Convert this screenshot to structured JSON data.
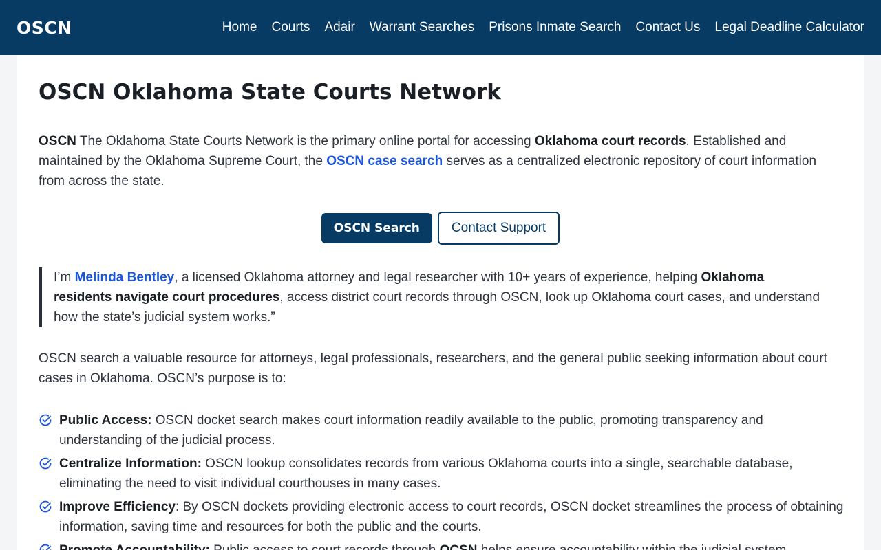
{
  "navbar": {
    "logo": "OSCN",
    "links": [
      "Home",
      "Courts",
      "Adair",
      "Warrant Searches",
      "Prisons Inmate Search",
      "Contact Us",
      "Legal Deadline Calculator"
    ]
  },
  "page": {
    "title": "OSCN Oklahoma State Courts Network",
    "intro": {
      "lead_bold": "OSCN",
      "t1": " The Oklahoma State Courts Network is the primary online portal for accessing ",
      "bold1": "Oklahoma court records",
      "t2": ". Established and maintained by the Oklahoma Supreme Court, the ",
      "link1": "OSCN case search",
      "t3": " serves as a centralized electronic repository of court information from across the state."
    },
    "buttons": {
      "primary": "OSCN Search",
      "secondary": "Contact Support"
    },
    "quote": {
      "t1": "I’m ",
      "author_link": "Melinda Bentley",
      "t2": ", a licensed Oklahoma attorney and legal researcher with 10+ years of experience, helping ",
      "bold1": "Oklahoma residents navigate court procedures",
      "t3": ", access district court records through OSCN, look up Oklahoma court cases, and understand how the state’s judicial system works.”"
    },
    "para2": "OSCN search a valuable resource for attorneys, legal professionals, researchers, and the general public seeking information about court cases in Oklahoma. OSCN’s purpose is to:",
    "purposes": [
      {
        "title": "Public Access:",
        "text": " OSCN docket search makes court information readily available to the public, promoting transparency and understanding of the judicial process."
      },
      {
        "title": "Centralize Information:",
        "text": " OSCN lookup consolidates records from various Oklahoma courts into a single, searchable database, eliminating the need to visit individual courthouses in many cases."
      },
      {
        "title": "Improve Efficiency",
        "text": ": By OSCN dockets providing electronic access to court records, OSCN docket streamlines the process of obtaining information, saving time and resources for both the public and the courts."
      },
      {
        "title": "Promote Accountability:",
        "text_pre": " Public access to court records through ",
        "text_bold": "OCSN",
        "text_post": " helps ensure accountability within the judicial system."
      }
    ]
  },
  "colors": {
    "navbar_bg": "#073b63",
    "link": "#1a56db",
    "check_icon": "#1a56db"
  }
}
